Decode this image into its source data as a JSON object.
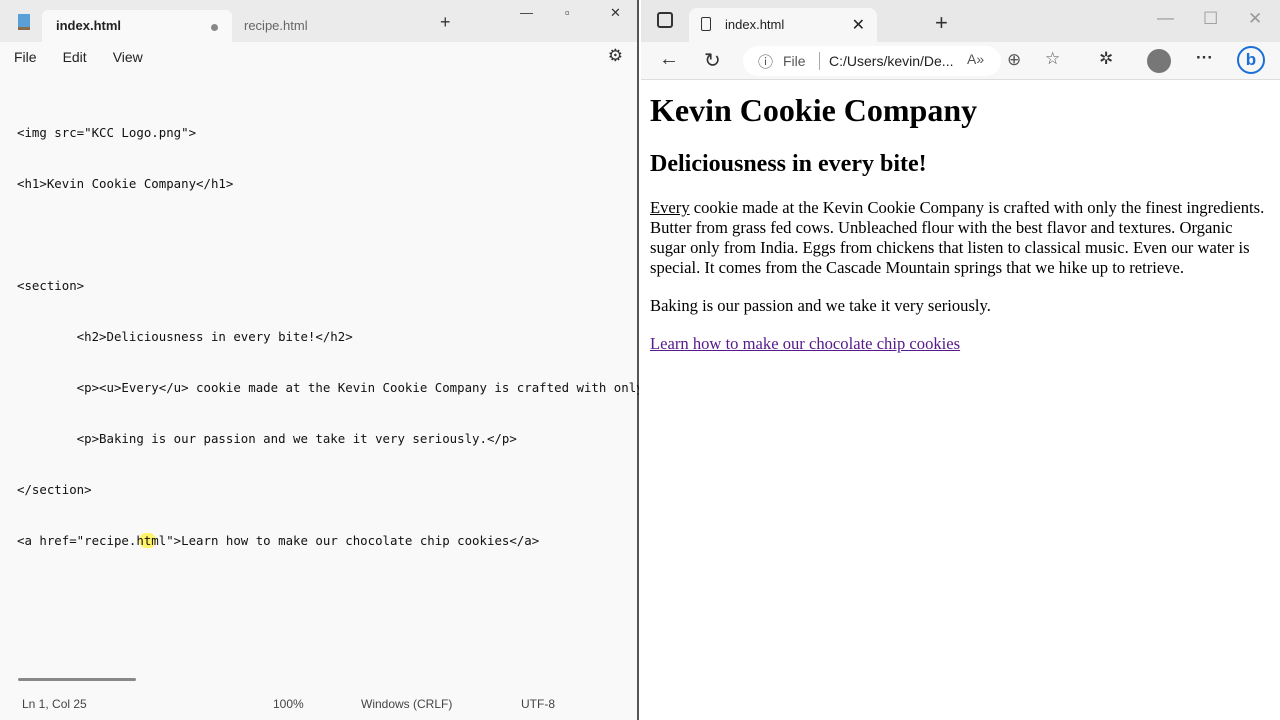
{
  "notepad": {
    "tabs": [
      {
        "label": "index.html",
        "active": true,
        "unsaved": true
      },
      {
        "label": "recipe.html",
        "active": false
      }
    ],
    "menu": [
      "File",
      "Edit",
      "View"
    ],
    "code_lines": [
      "<img src=\"KCC Logo.png\">",
      "<h1>Kevin Cookie Company</h1>",
      "",
      "<section>",
      "        <h2>Deliciousness in every bite!</h2>",
      "        <p><u>Every</u> cookie made at the Kevin Cookie Company is crafted with only the finest ingredients.",
      "        <p>Baking is our passion and we take it very seriously.</p>",
      "</section>"
    ],
    "last_line": {
      "before": "<a href=\"recipe.",
      "highlight": "htm",
      "after": "l\">Learn how to make our chocolate chip cookies</a>"
    },
    "status": {
      "position": "Ln 1, Col 25",
      "zoom": "100%",
      "line_ending": "Windows (CRLF)",
      "encoding": "UTF-8"
    }
  },
  "browser": {
    "tab_title": "index.html",
    "address_scheme": "File",
    "address": "C:/Users/kevin/De...",
    "page": {
      "h1": "Kevin Cookie Company",
      "h2": "Deliciousness in every bite!",
      "p1_underlined": "Every",
      "p1_rest": " cookie made at the Kevin Cookie Company is crafted with only the finest ingredients. Butter from grass fed cows. Unbleached flour with the best flavor and textures. Organic sugar only from India. Eggs from chickens that listen to classical music. Even our water is special. It comes from the Cascade Mountain springs that we hike up to retrieve.",
      "p2": "Baking is our passion and we take it very seriously.",
      "link": "Learn how to make our chocolate chip cookies"
    },
    "colors": {
      "link_visited": "#551a8b",
      "bing": "#1b6fd8"
    }
  }
}
